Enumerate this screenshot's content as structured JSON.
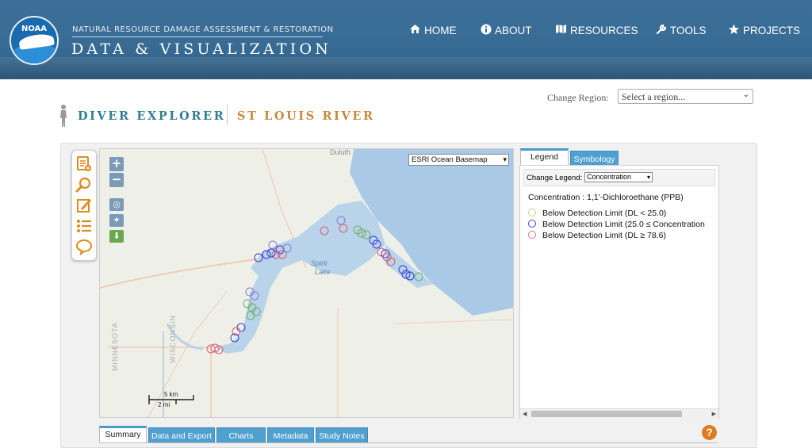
{
  "header": {
    "agency_small": "NATURAL RESOURCE DAMAGE ASSESSMENT & RESTORATION",
    "agency_big": "DATA & VISUALIZATION",
    "logo_text": "NOAA",
    "nav": [
      {
        "label": "HOME",
        "icon": "home-icon"
      },
      {
        "label": "ABOUT",
        "icon": "info-icon"
      },
      {
        "label": "RESOURCES",
        "icon": "map-icon"
      },
      {
        "label": "TOOLS",
        "icon": "wrench-icon"
      },
      {
        "label": "PROJECTS",
        "icon": "star-icon"
      }
    ]
  },
  "region": {
    "label": "Change Region:",
    "placeholder": "Select a region..."
  },
  "titles": {
    "app": "DIVER EXPLORER",
    "project": "ST LOUIS RIVER"
  },
  "map": {
    "basemap": "ESRI Ocean Basemap",
    "place_duluth": "Duluth",
    "place_lake_line1": "Spirit",
    "place_lake_line2": "Lake",
    "state_mn": "MINNESOTA",
    "state_wi": "WISCONSIN",
    "scale_km": "5 km",
    "scale_mi": "2 mi",
    "tools": [
      "add-document-icon",
      "search-icon",
      "edit-icon",
      "list-icon",
      "comment-icon"
    ],
    "colors": {
      "below_25": "#8ec97a",
      "conc_mid": "#3a3ad0",
      "conc_high": "#e04040",
      "water": "#a9c9e6",
      "land": "#eef0e8"
    }
  },
  "legend": {
    "tabs": [
      "Legend",
      "Symbology"
    ],
    "change_label": "Change Legend:",
    "change_value": "Concentration",
    "title_prefix": "Concentration : ",
    "title_chem": "1,1'-Dichloroethane (PPB)",
    "items": [
      {
        "label": "Below Detection Limit (DL < 25.0)",
        "color": "#c4d68a"
      },
      {
        "label": "Below Detection Limit (25.0 ≤ Concentration",
        "color": "#4040c0"
      },
      {
        "label": "Below Detection Limit (DL ≥ 78.6)",
        "color": "#e07080"
      }
    ]
  },
  "bottom_tabs": [
    "Summary",
    "Data and Export",
    "Charts",
    "Metadata",
    "Study Notes"
  ],
  "help": "?"
}
